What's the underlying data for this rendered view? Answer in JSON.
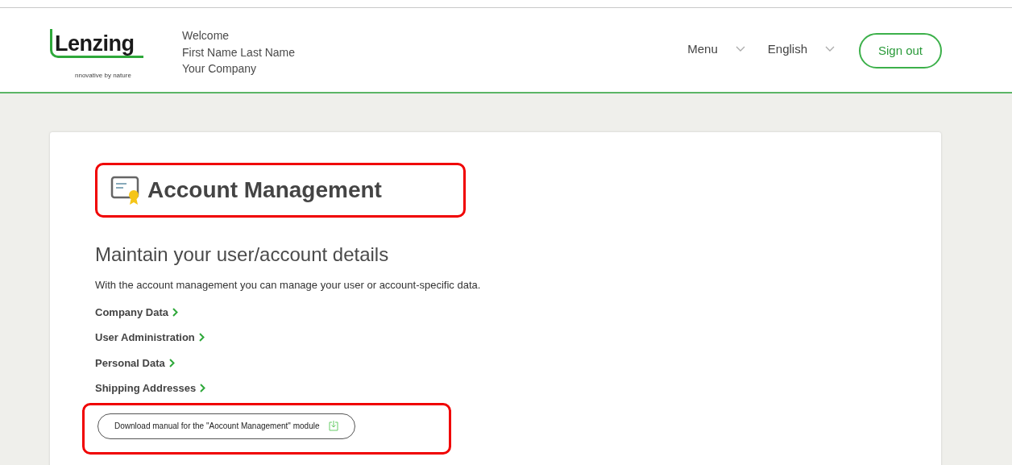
{
  "header": {
    "logo": {
      "name": "Lenzing",
      "tagline": "nnovative by nature"
    },
    "user": [
      "Welcome",
      "First Name Last Name",
      "Your Company"
    ],
    "nav": [
      {
        "label": "Menu"
      },
      {
        "label": "English"
      }
    ],
    "sign_out": "Sign out"
  },
  "page": {
    "title": "Account Management",
    "title_highlighted": true,
    "subtitle": "Maintain your user/account details",
    "description": "With the account management you can manage your user or account-specific data.",
    "links": [
      {
        "label": "Company Data"
      },
      {
        "label": "User Administration"
      },
      {
        "label": "Personal Data"
      },
      {
        "label": "Shipping Addresses"
      }
    ],
    "download": {
      "label": "Download manual for the \"Aocount Management\" module",
      "highlighted": true
    }
  }
}
